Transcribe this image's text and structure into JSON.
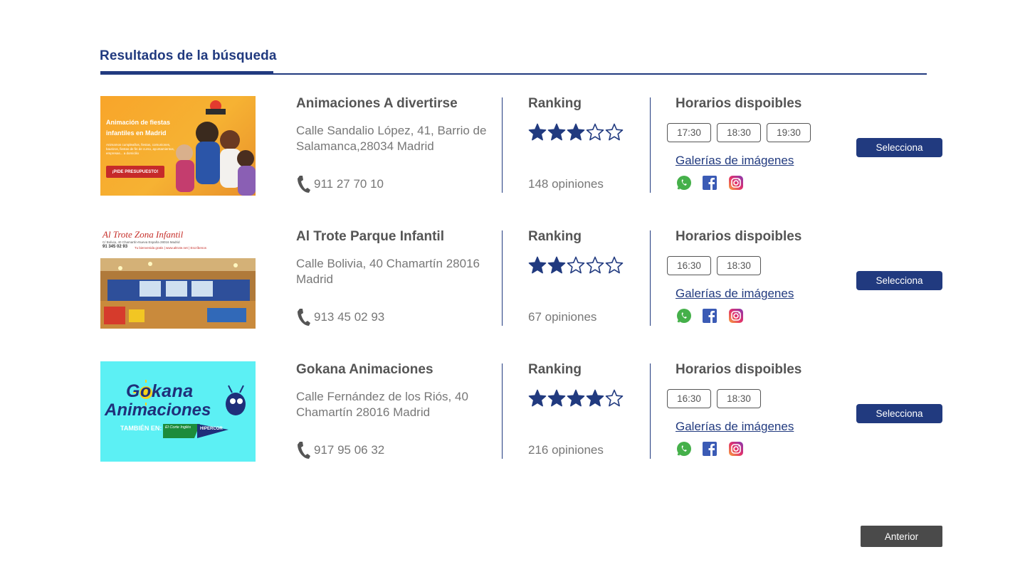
{
  "page": {
    "title": "Resultados de la búsqueda",
    "anterior_label": "Anterior"
  },
  "colors": {
    "accent": "#213a7f",
    "text": "#555555",
    "muted": "#777777"
  },
  "labels": {
    "ranking": "Ranking",
    "horarios": "Horarios dispoibles",
    "gallery": "Galerías de imágenes",
    "select": "Selecciona"
  },
  "results": [
    {
      "name": "Animaciones A divertirse",
      "address": "Calle Sandalio López, 41, Barrio de Salamanca,28034 Madrid",
      "phone": "911 27 70 10",
      "rating": 3,
      "max_rating": 5,
      "opinions": "148 opiniones",
      "slots": [
        "17:30",
        "18:30",
        "19:30"
      ],
      "image": {
        "headline": "Animación de fiestas infantiles en Madrid",
        "body": "Animamos cumpleaños, fiestas, comuniones, bautizos, fiestas de fin de curso, ayuntamientos, empresas... a domicilio",
        "cta": "¡PIDE PRESUPUESTO!"
      }
    },
    {
      "name": "Al Trote Parque Infantil",
      "address": "Calle Bolivia, 40 Chamartín 28016 Madrid",
      "phone": "913 45 02 93",
      "rating": 2,
      "max_rating": 5,
      "opinions": "67 opiniones",
      "slots": [
        "16:30",
        "18:30"
      ],
      "image": {
        "headline": "Al Trote Zona Infantil",
        "body": "C/ Bolivia, 40 Chamartín-Nueva España 28016 Madrid",
        "phone": "91 345 02 93",
        "links": "Tu bienvenida gratis | www.altrote.net | Escríbenos"
      }
    },
    {
      "name": "Gokana Animaciones",
      "address": "Calle Fernández de los Riós, 40 Chamartín 28016 Madrid",
      "phone": "917 95 06 32",
      "rating": 4,
      "max_rating": 5,
      "opinions": "216 opiniones",
      "slots": [
        "16:30",
        "18:30"
      ],
      "image": {
        "logo_line1": "Gokana",
        "logo_line2": "Animaciones",
        "tambien": "TAMBIÉN EN:",
        "store1": "El Corte Inglés",
        "store2": "HIPERCOR"
      }
    }
  ],
  "icons": [
    "phone-icon",
    "star-icon",
    "whatsapp-icon",
    "facebook-icon",
    "instagram-icon"
  ]
}
